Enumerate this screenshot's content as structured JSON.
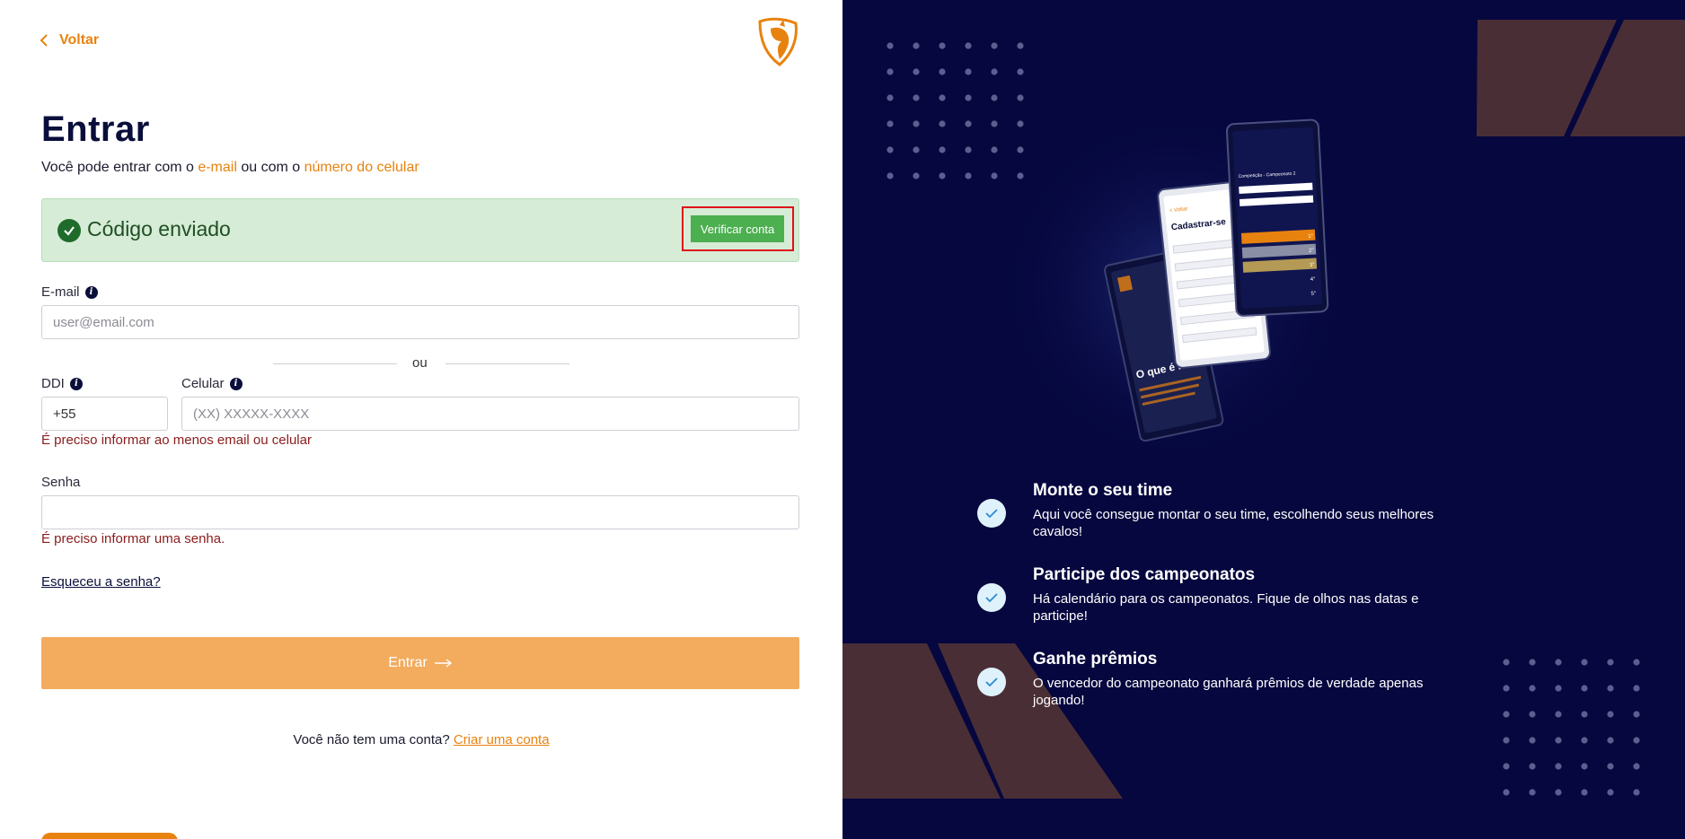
{
  "back": {
    "label": "Voltar"
  },
  "header": {
    "title": "Entrar",
    "subtitle_prefix": "Você pode entrar com o ",
    "subtitle_email": "e-mail",
    "subtitle_middle": " ou com o ",
    "subtitle_phone": "número do celular"
  },
  "alert": {
    "message": "Código enviado",
    "button": "Verificar conta"
  },
  "form": {
    "email_label": "E-mail",
    "email_placeholder": "user@email.com",
    "or_text": "ou",
    "ddi_label": "DDI",
    "ddi_value": "+55",
    "phone_label": "Celular",
    "phone_placeholder": "(XX) XXXXX-XXXX",
    "contact_error": "É preciso informar ao menos email ou celular",
    "password_label": "Senha",
    "password_value": "",
    "password_error": "É preciso informar uma senha.",
    "forgot": "Esqueceu a senha?",
    "submit": "Entrar"
  },
  "signup": {
    "text": "Você não tem uma conta?",
    "link": "Criar uma conta"
  },
  "phone_mock": {
    "screen_title": "Cadastrar-se",
    "screen_back": "< Voltar",
    "promo_title": "O que é Pisteiro?",
    "header": "Competição - Campeonato 2",
    "ranks": [
      "1°",
      "2°",
      "3°",
      "4°",
      "5°"
    ]
  },
  "features": [
    {
      "title": "Monte o seu time",
      "text": "Aqui você consegue montar o seu time, escolhendo seus melhores cavalos!"
    },
    {
      "title": "Participe dos campeonatos",
      "text": "Há calendário para os campeonatos. Fique de olhos nas datas e participe!"
    },
    {
      "title": "Ganhe prêmios",
      "text": "O vencedor do campeonato ganhará prêmios de verdade apenas jogando!"
    }
  ],
  "colors": {
    "accent": "#e8820f",
    "navy": "#06073f",
    "success": "#4caf50",
    "error": "#8a1c1c",
    "highlight": "#e0101a"
  }
}
